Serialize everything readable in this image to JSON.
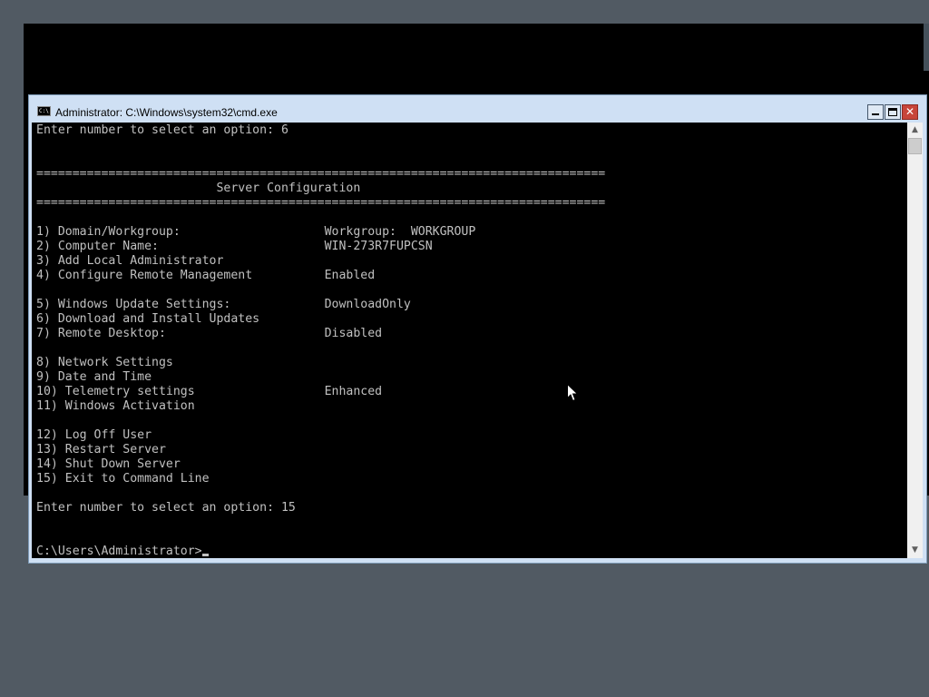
{
  "window": {
    "title": "Administrator: C:\\Windows\\system32\\cmd.exe",
    "icon_text": "C:\\",
    "close_label": "✕"
  },
  "console": {
    "lines": [
      "Enter number to select an option: 6",
      "",
      "",
      "===============================================================================",
      "                         Server Configuration",
      "===============================================================================",
      "",
      "1) Domain/Workgroup:                    Workgroup:  WORKGROUP",
      "2) Computer Name:                       WIN-273R7FUPCSN",
      "3) Add Local Administrator",
      "4) Configure Remote Management          Enabled",
      "",
      "5) Windows Update Settings:             DownloadOnly",
      "6) Download and Install Updates",
      "7) Remote Desktop:                      Disabled",
      "",
      "8) Network Settings",
      "9) Date and Time",
      "10) Telemetry settings                  Enhanced",
      "11) Windows Activation",
      "",
      "12) Log Off User",
      "13) Restart Server",
      "14) Shut Down Server",
      "15) Exit to Command Line",
      "",
      "Enter number to select an option: 15",
      "",
      "",
      "C:\\Users\\Administrator>"
    ]
  },
  "colors": {
    "desktop": "#515a63",
    "console_background": "#000000",
    "console_text": "#c0c0c0",
    "titlebar": "#cfe0f4",
    "close_button": "#c7453a"
  }
}
